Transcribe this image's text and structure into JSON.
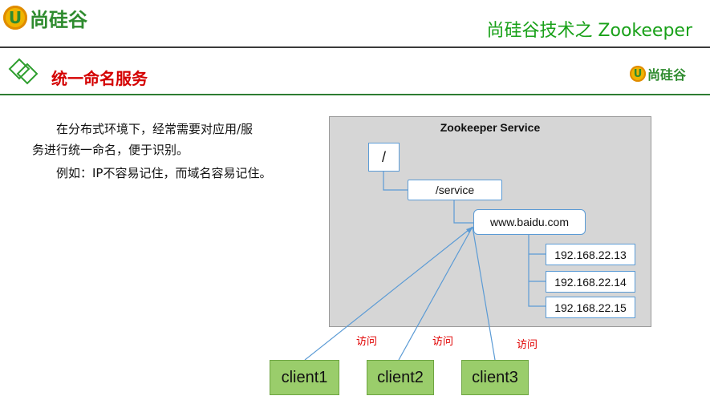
{
  "brand": {
    "logo_letter": "U",
    "logo_text": "尚硅谷",
    "small_logo_letter": "U",
    "small_logo_text": "尚硅谷"
  },
  "header": {
    "title": "尚硅谷技术之 Zookeeper"
  },
  "section": {
    "title": "统一命名服务",
    "icon": "diamond-icon"
  },
  "content": {
    "paragraph1_line1": "在分布式环境下，经常需要对应用/服",
    "paragraph1_line2": "务进行统一命名，便于识别。",
    "paragraph2": "例如：IP不容易记住，而域名容易记住。"
  },
  "diagram": {
    "service_title": "Zookeeper Service",
    "root_node": "/",
    "service_node": "/service",
    "domain_node": "www.baidu.com",
    "ips": [
      "192.168.22.13",
      "192.168.22.14",
      "192.168.22.15"
    ],
    "clients": [
      "client1",
      "client2",
      "client3"
    ],
    "visit_label": "访问"
  },
  "colors": {
    "header_title": "#19a119",
    "section_title": "#d40000",
    "client_fill": "#9acd6b",
    "node_border": "#5b9bd5",
    "visit_text": "#e00000"
  }
}
